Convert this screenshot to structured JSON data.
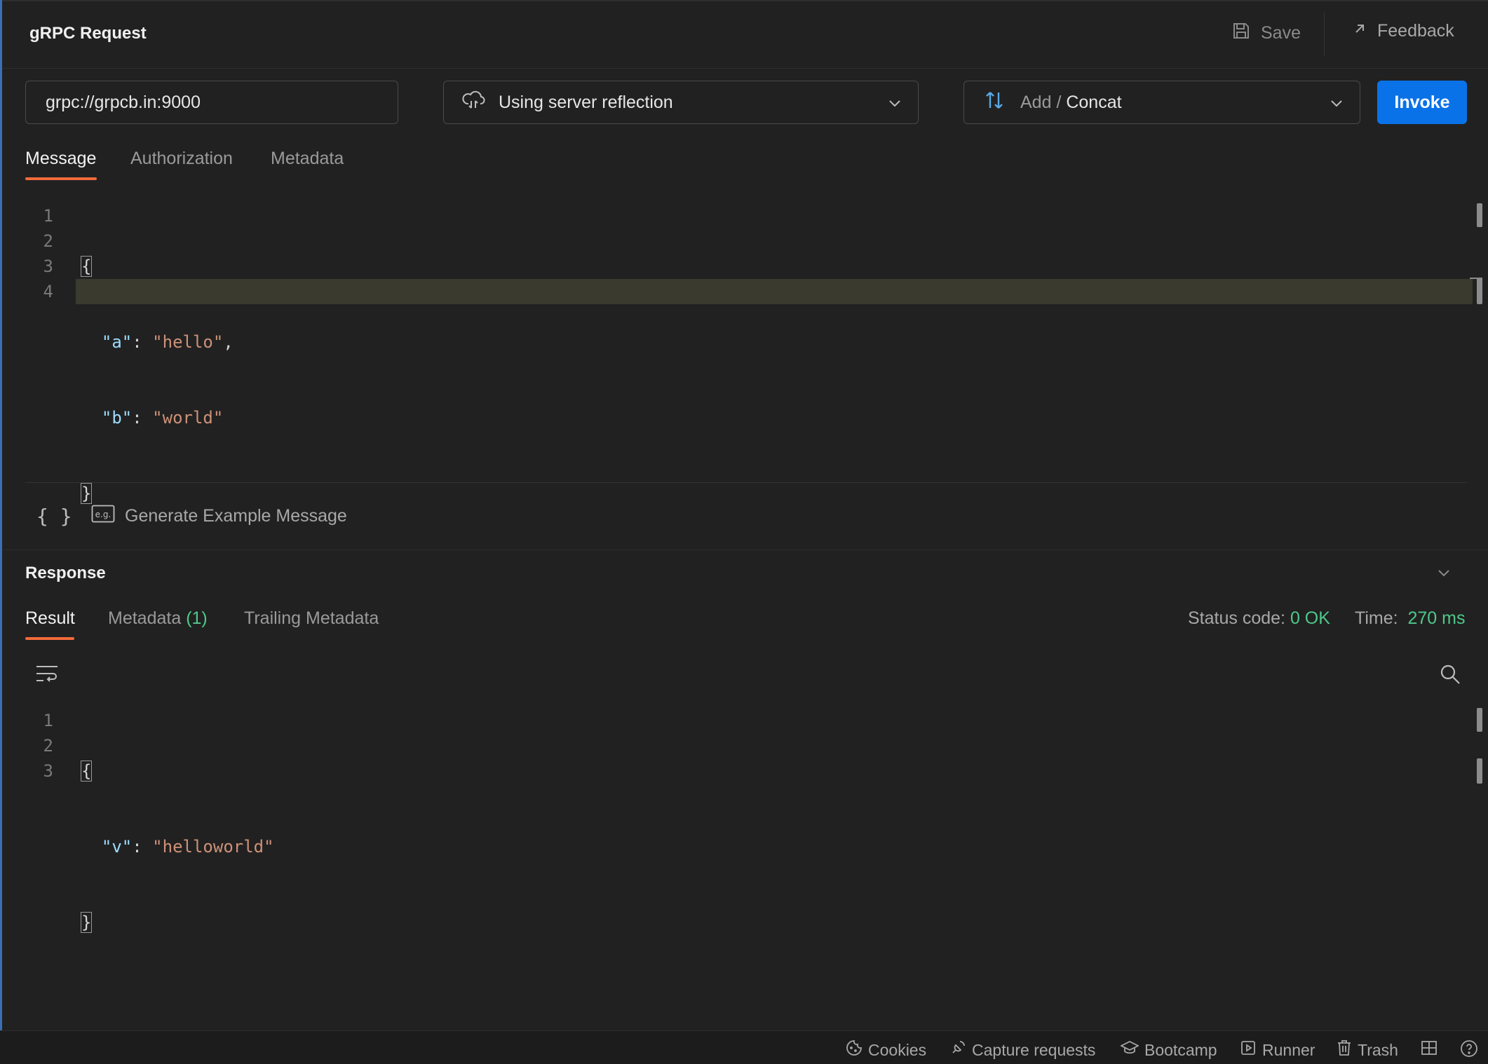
{
  "header": {
    "title": "gRPC Request",
    "save_label": "Save",
    "feedback_label": "Feedback"
  },
  "request": {
    "url": "grpc://grpcb.in:9000",
    "reflection_label": "Using server reflection",
    "method_service": "Add",
    "method_sep": "/",
    "method_name": "Concat",
    "invoke_label": "Invoke"
  },
  "request_tabs": [
    {
      "label": "Message"
    },
    {
      "label": "Authorization"
    },
    {
      "label": "Metadata"
    }
  ],
  "message_editor": {
    "lines": [
      "1",
      "2",
      "3",
      "4"
    ],
    "open_brace": "{",
    "close_brace": "}",
    "key_a": "\"a\"",
    "val_a": "\"hello\"",
    "key_b": "\"b\"",
    "val_b": "\"world\"",
    "colon": ":",
    "comma": ","
  },
  "generate_label": "Generate Example Message",
  "response": {
    "title": "Response",
    "tabs": {
      "result": "Result",
      "metadata": "Metadata",
      "metadata_count": "(1)",
      "trailing": "Trailing Metadata"
    },
    "status_label": "Status code:",
    "status_value": "0 OK",
    "time_label": "Time:",
    "time_value": "270 ms"
  },
  "response_editor": {
    "lines": [
      "1",
      "2",
      "3"
    ],
    "open_brace": "{",
    "close_brace": "}",
    "key_v": "\"v\"",
    "val_v": "\"helloworld\"",
    "colon": ":"
  },
  "statusbar": {
    "cookies": "Cookies",
    "capture": "Capture requests",
    "bootcamp": "Bootcamp",
    "runner": "Runner",
    "trash": "Trash"
  },
  "colors": {
    "accent": "#f26b3a",
    "invoke": "#0a72e8",
    "success": "#4ec98a"
  }
}
